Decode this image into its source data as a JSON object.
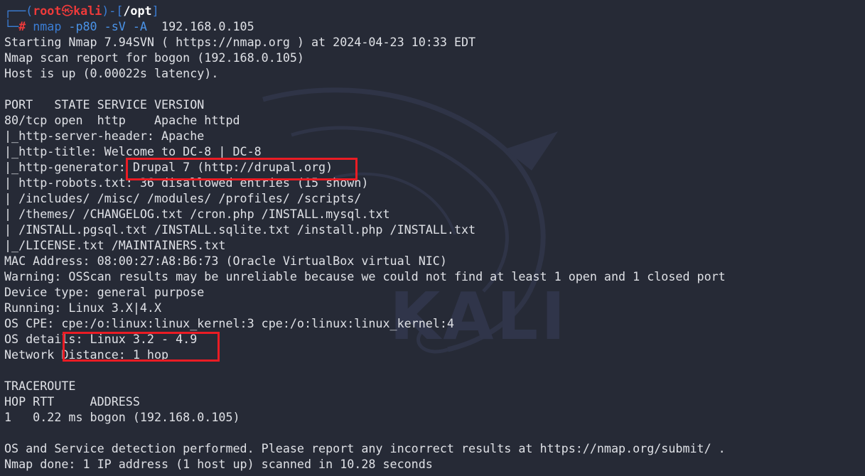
{
  "prompt": {
    "top_left": "┌──(",
    "user": "root",
    "at": "㉿",
    "host": "kali",
    "sep": ")-[",
    "cwd": "/opt",
    "close": "]",
    "bottom_left": "└─",
    "hash": "#"
  },
  "command": {
    "name": "nmap",
    "args": "-p80 -sV -A",
    "target": "192.168.0.105"
  },
  "output": [
    "Starting Nmap 7.94SVN ( https://nmap.org ) at 2024-04-23 10:33 EDT",
    "Nmap scan report for bogon (192.168.0.105)",
    "Host is up (0.00022s latency).",
    "",
    "PORT   STATE SERVICE VERSION",
    "80/tcp open  http    Apache httpd",
    "|_http-server-header: Apache",
    "|_http-title: Welcome to DC-8 | DC-8",
    "|_http-generator: Drupal 7 (http://drupal.org)",
    "| http-robots.txt: 36 disallowed entries (15 shown)",
    "| /includes/ /misc/ /modules/ /profiles/ /scripts/",
    "| /themes/ /CHANGELOG.txt /cron.php /INSTALL.mysql.txt",
    "| /INSTALL.pgsql.txt /INSTALL.sqlite.txt /install.php /INSTALL.txt",
    "|_/LICENSE.txt /MAINTAINERS.txt",
    "MAC Address: 08:00:27:A8:B6:73 (Oracle VirtualBox virtual NIC)",
    "Warning: OSScan results may be unreliable because we could not find at least 1 open and 1 closed port",
    "Device type: general purpose",
    "Running: Linux 3.X|4.X",
    "OS CPE: cpe:/o:linux:linux_kernel:3 cpe:/o:linux:linux_kernel:4",
    "OS details: Linux 3.2 - 4.9",
    "Network Distance: 1 hop",
    "",
    "TRACEROUTE",
    "HOP RTT     ADDRESS",
    "1   0.22 ms bogon (192.168.0.105)",
    "",
    "OS and Service detection performed. Please report any incorrect results at https://nmap.org/submit/ .",
    "Nmap done: 1 IP address (1 host up) scanned in 10.28 seconds"
  ],
  "watermark": "KALI",
  "colors": {
    "background": "#262a36",
    "text": "#dfe1e6",
    "prompt_user": "#ee3a3a",
    "prompt_decoration": "#3b7ed6",
    "highlight_border": "#ea1c24"
  }
}
